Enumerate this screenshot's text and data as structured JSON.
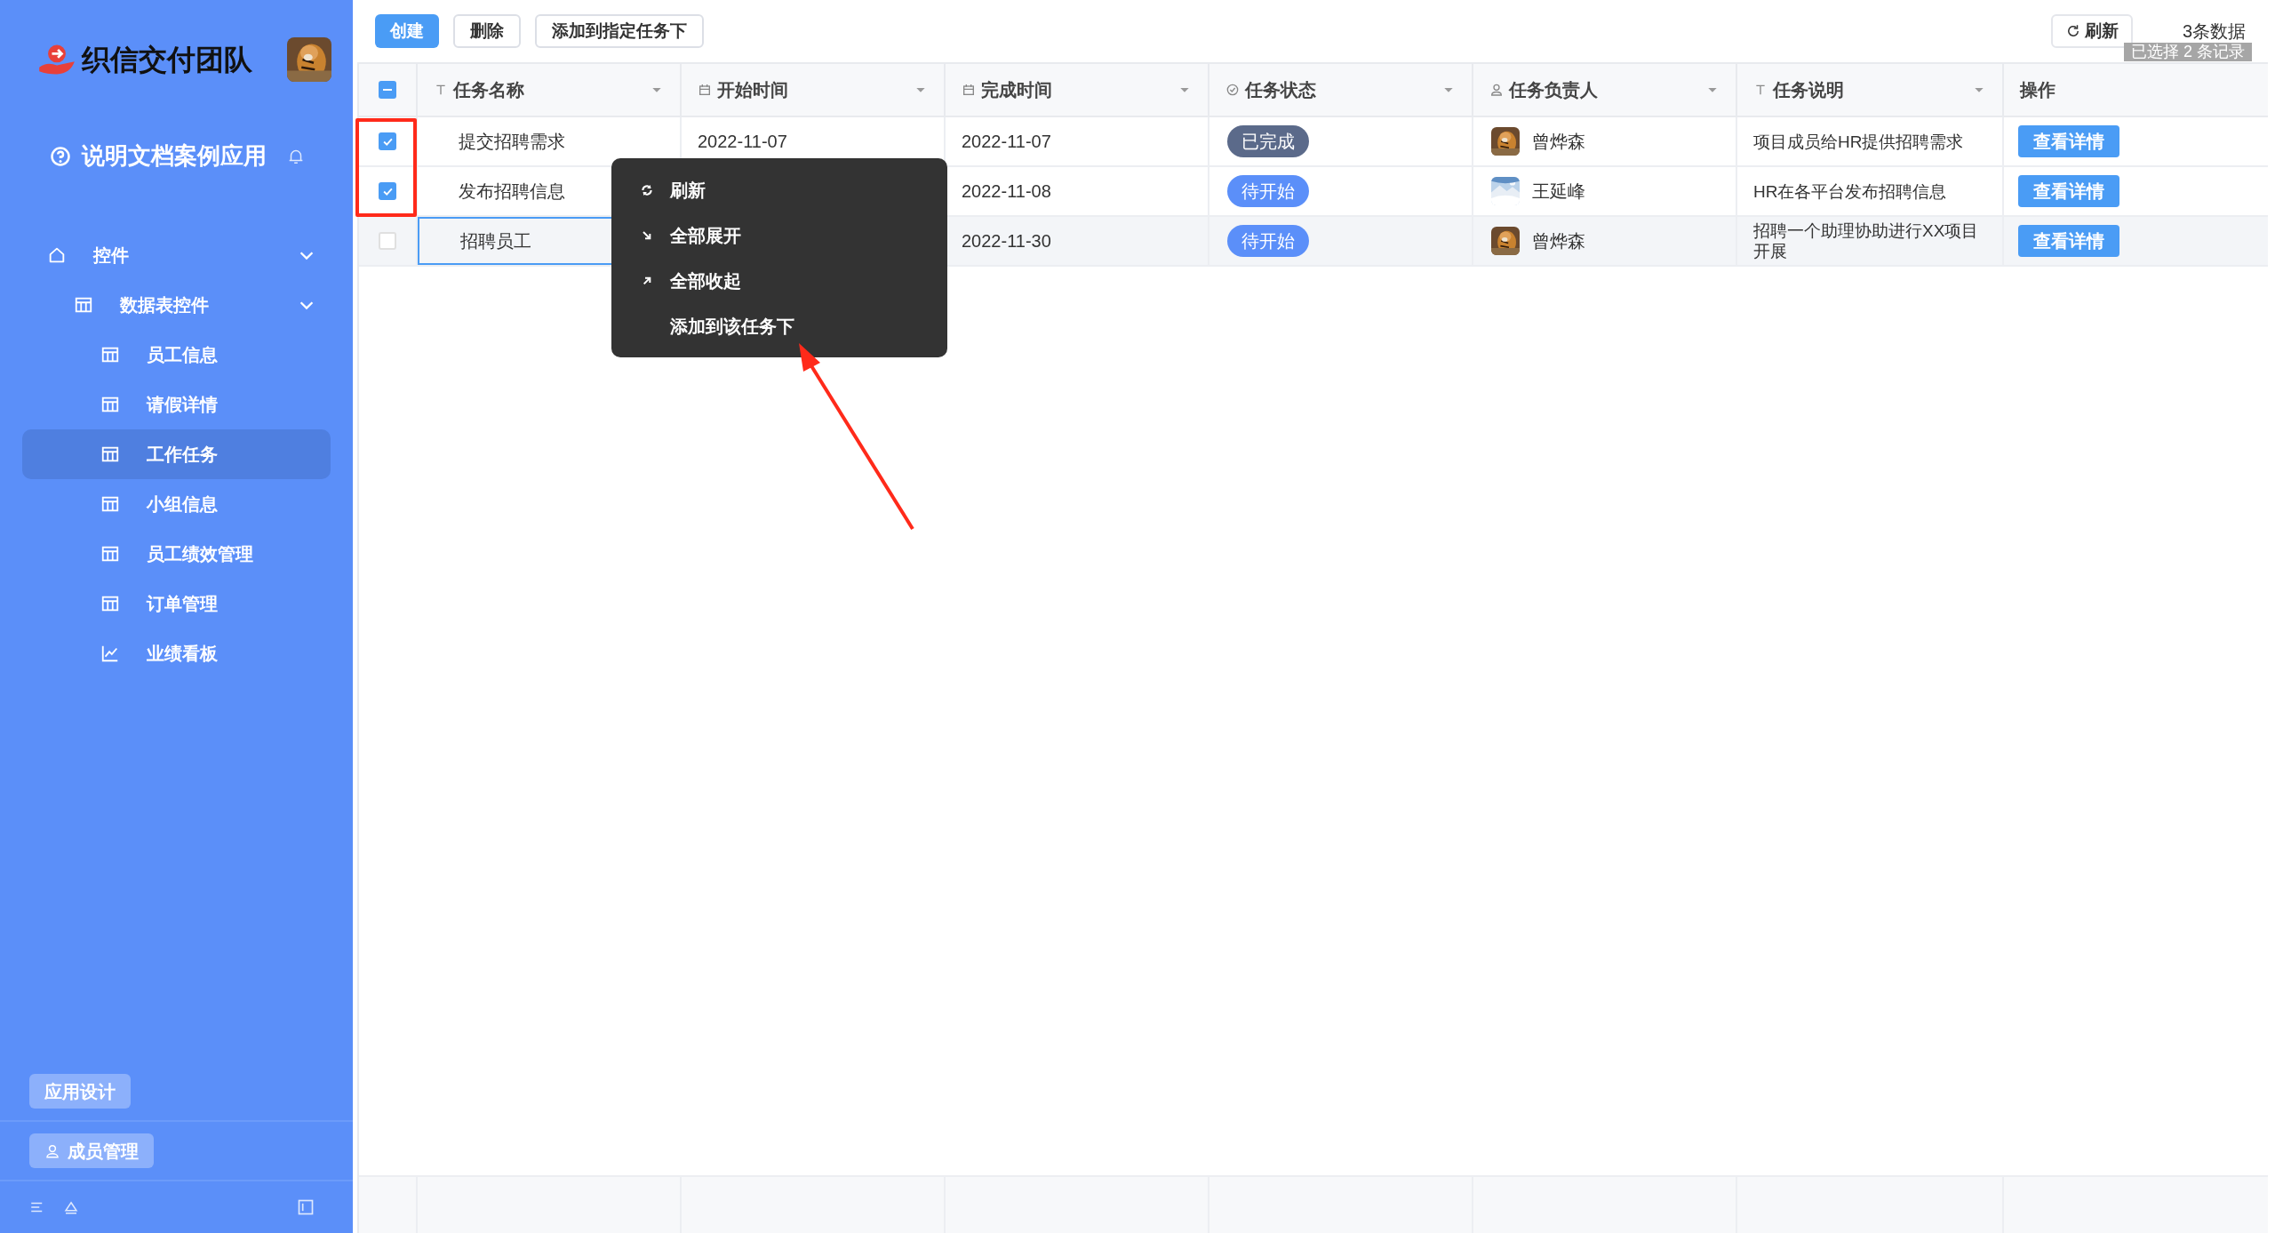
{
  "sidebar": {
    "logo_text": "织信交付团队",
    "app_title": "说明文档案例应用",
    "menu": [
      {
        "label": "控件",
        "kind": "home",
        "expanded": true,
        "selected": false,
        "children": [
          {
            "label": "数据表控件",
            "kind": "table",
            "expanded": true,
            "selected": false,
            "children": [
              {
                "label": "员工信息",
                "kind": "table",
                "selected": false
              },
              {
                "label": "请假详情",
                "kind": "table",
                "selected": false
              },
              {
                "label": "工作任务",
                "kind": "table",
                "selected": true
              },
              {
                "label": "小组信息",
                "kind": "table",
                "selected": false
              },
              {
                "label": "员工绩效管理",
                "kind": "table",
                "selected": false
              },
              {
                "label": "订单管理",
                "kind": "table",
                "selected": false
              },
              {
                "label": "业绩看板",
                "kind": "chart",
                "selected": false
              }
            ]
          }
        ]
      }
    ],
    "buttons": [
      {
        "label": "应用设计",
        "kind": "plain"
      },
      {
        "label": "成员管理",
        "kind": "member"
      }
    ]
  },
  "toolbar": {
    "buttons": [
      {
        "label": "创建",
        "primary": true
      },
      {
        "label": "删除",
        "primary": false
      },
      {
        "label": "添加到指定任务下",
        "primary": false
      }
    ],
    "refresh": "刷新",
    "count": "3条数据",
    "selection_note": "已选择 2 条记录"
  },
  "table": {
    "select_all_indeterminate": true,
    "columns": [
      {
        "label": "任务名称",
        "kind": "text"
      },
      {
        "label": "开始时间",
        "kind": "date"
      },
      {
        "label": "完成时间",
        "kind": "date"
      },
      {
        "label": "任务状态",
        "kind": "status"
      },
      {
        "label": "任务负责人",
        "kind": "person"
      },
      {
        "label": "任务说明",
        "kind": "text"
      },
      {
        "label": "操作",
        "kind": "plain"
      }
    ],
    "rows": [
      {
        "checked": true,
        "highlighted": false,
        "focused": false,
        "name": "提交招聘需求",
        "start": "2022-11-07",
        "end": "2022-11-07",
        "status": {
          "label": "已完成",
          "color": "#5b6a8a"
        },
        "owner": "曾烨森",
        "description": "项目成员给HR提供招聘需求",
        "action": "查看详情"
      },
      {
        "checked": true,
        "highlighted": false,
        "focused": false,
        "name": "发布招聘信息",
        "end": "2022-11-08",
        "status": {
          "label": "待开始",
          "color": "#5b8ff9"
        },
        "owner": "王延峰",
        "description": "HR在各平台发布招聘信息",
        "action": "查看详情"
      },
      {
        "checked": false,
        "highlighted": true,
        "focused": true,
        "name": "招聘员工",
        "end": "2022-11-30",
        "status": {
          "label": "待开始",
          "color": "#5b8ff9"
        },
        "owner": "曾烨森",
        "description": "招聘一个助理协助进行XX项目开展",
        "action": "查看详情"
      }
    ]
  },
  "context_menu": {
    "items": [
      {
        "label": "刷新",
        "kind": "refresh"
      },
      {
        "label": "全部展开",
        "kind": "expand"
      },
      {
        "label": "全部收起",
        "kind": "collapse"
      },
      {
        "label": "添加到该任务下",
        "kind": "none"
      }
    ]
  }
}
